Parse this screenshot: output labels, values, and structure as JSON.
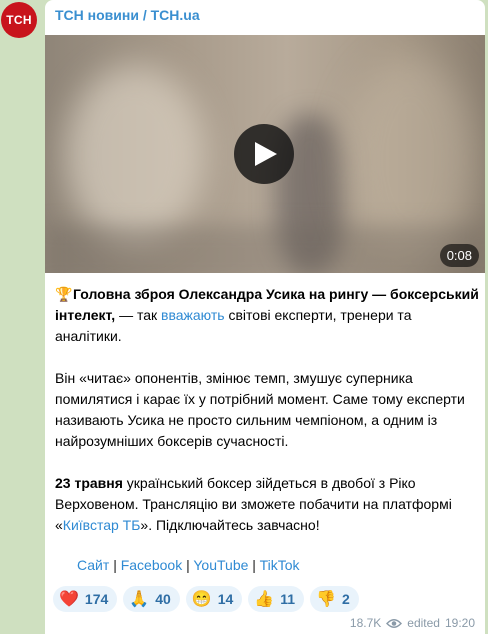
{
  "channel": {
    "avatar_text": "TCH",
    "name": "ТСН новини / TCH.ua"
  },
  "video": {
    "duration": "0:08",
    "play_icon": "play-icon"
  },
  "post": {
    "p1_emoji": "🏆",
    "p1_bold": "Головна зброя Олександра Усика на рингу — боксерський інтелект,",
    "p1_text1": " — так ",
    "p1_link": "вважають",
    "p1_text2": " світові експерти, тренери та аналітики.",
    "p2": "Він «читає» опонентів, змінює темп, змушує суперника помилятися і карає їх у потрібний момент. Саме тому експерти називають Усика не просто сильним чемпіоном, а одним із найрозумніших боксерів сучасності.",
    "p3_bold": "23 травня",
    "p3_text1": " український боксер зійдеться в двобої з Ріко Верховеном. Трансляцію ви зможете побачити на платформі «",
    "p3_link": "Київстар ТБ",
    "p3_text2": "». Підключайтесь завчасно!"
  },
  "links": [
    {
      "label": "Сайт"
    },
    {
      "label": "Facebook"
    },
    {
      "label": "YouTube"
    },
    {
      "label": "TikTok"
    }
  ],
  "separator": "|",
  "reactions": [
    {
      "emoji": "❤️",
      "count": "174"
    },
    {
      "emoji": "🙏",
      "count": "40"
    },
    {
      "emoji": "😁",
      "count": "14"
    },
    {
      "emoji": "👍",
      "count": "11"
    },
    {
      "emoji": "👎",
      "count": "2"
    }
  ],
  "meta": {
    "views": "18.7K",
    "views_icon": "eye-icon",
    "edited": "edited",
    "time": "19:20"
  },
  "colors": {
    "accent": "#3a8fd0",
    "avatar": "#c8141c",
    "background": "#cfe0c0"
  }
}
